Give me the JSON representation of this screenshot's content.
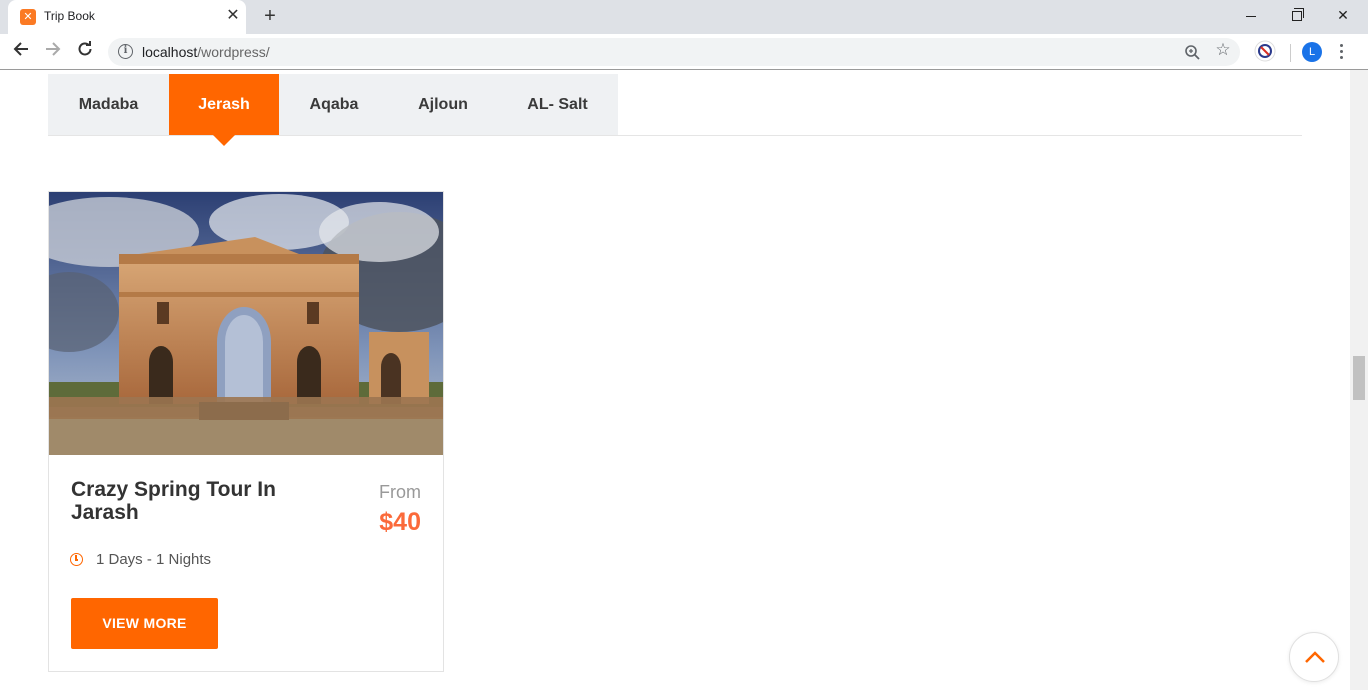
{
  "browser": {
    "tab_title": "Trip Book",
    "tab_favicon": "xampp-logo",
    "url_host": "localhost",
    "url_path": "/wordpress/",
    "profile_initial": "L"
  },
  "city_tabs": [
    {
      "label": "Madaba",
      "active": false
    },
    {
      "label": "Jerash",
      "active": true
    },
    {
      "label": "Aqaba",
      "active": false
    },
    {
      "label": "Ajloun",
      "active": false
    },
    {
      "label": "AL- Salt",
      "active": false
    }
  ],
  "tour_card": {
    "image": "jerash-hadrians-arch-photo",
    "title": "Crazy Spring Tour In Jarash",
    "price_label": "From",
    "price": "$40",
    "duration": "1 Days - 1 Nights",
    "button_label": "VIEW MORE"
  },
  "colors": {
    "accent": "#ff6600",
    "price": "#fb6a3a",
    "tabs_bg": "#eff1f3"
  }
}
